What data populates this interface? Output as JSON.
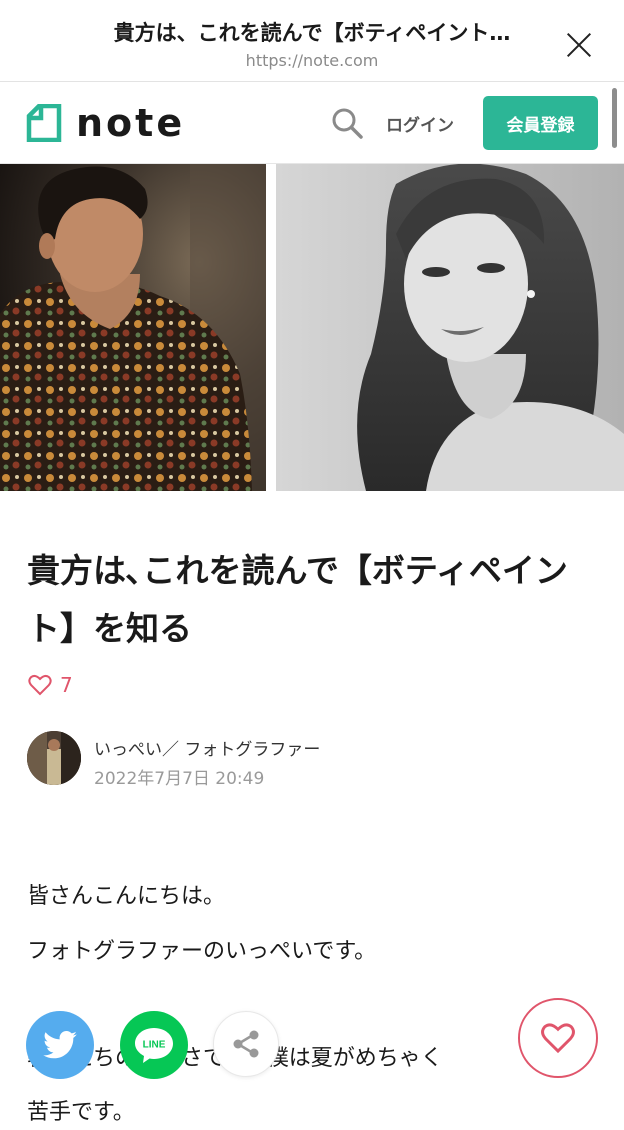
{
  "browser": {
    "title": "貴方は、これを読んで【ボティペイント…",
    "url": "https://note.com"
  },
  "header": {
    "logo_text": "note",
    "login_label": "ログイン",
    "signup_label": "会員登録"
  },
  "article": {
    "title": "貴方は､これを読んで【ボティペイント】を知る",
    "like_count": "7",
    "author_name": "いっぺい／ フォトグラファー",
    "date": "2022年7月7日 20:49",
    "body": [
      "皆さんこんにちは。",
      "フォトグラファーのいっぺいです。",
      "暑いたちのご暑さです。僕は夏がめちゃく",
      "苦手です。"
    ]
  },
  "share": {
    "line_label": "LINE"
  },
  "colors": {
    "brand_green": "#2cb696",
    "like_red": "#e0556b",
    "twitter_blue": "#55acee",
    "line_green": "#06c755"
  }
}
